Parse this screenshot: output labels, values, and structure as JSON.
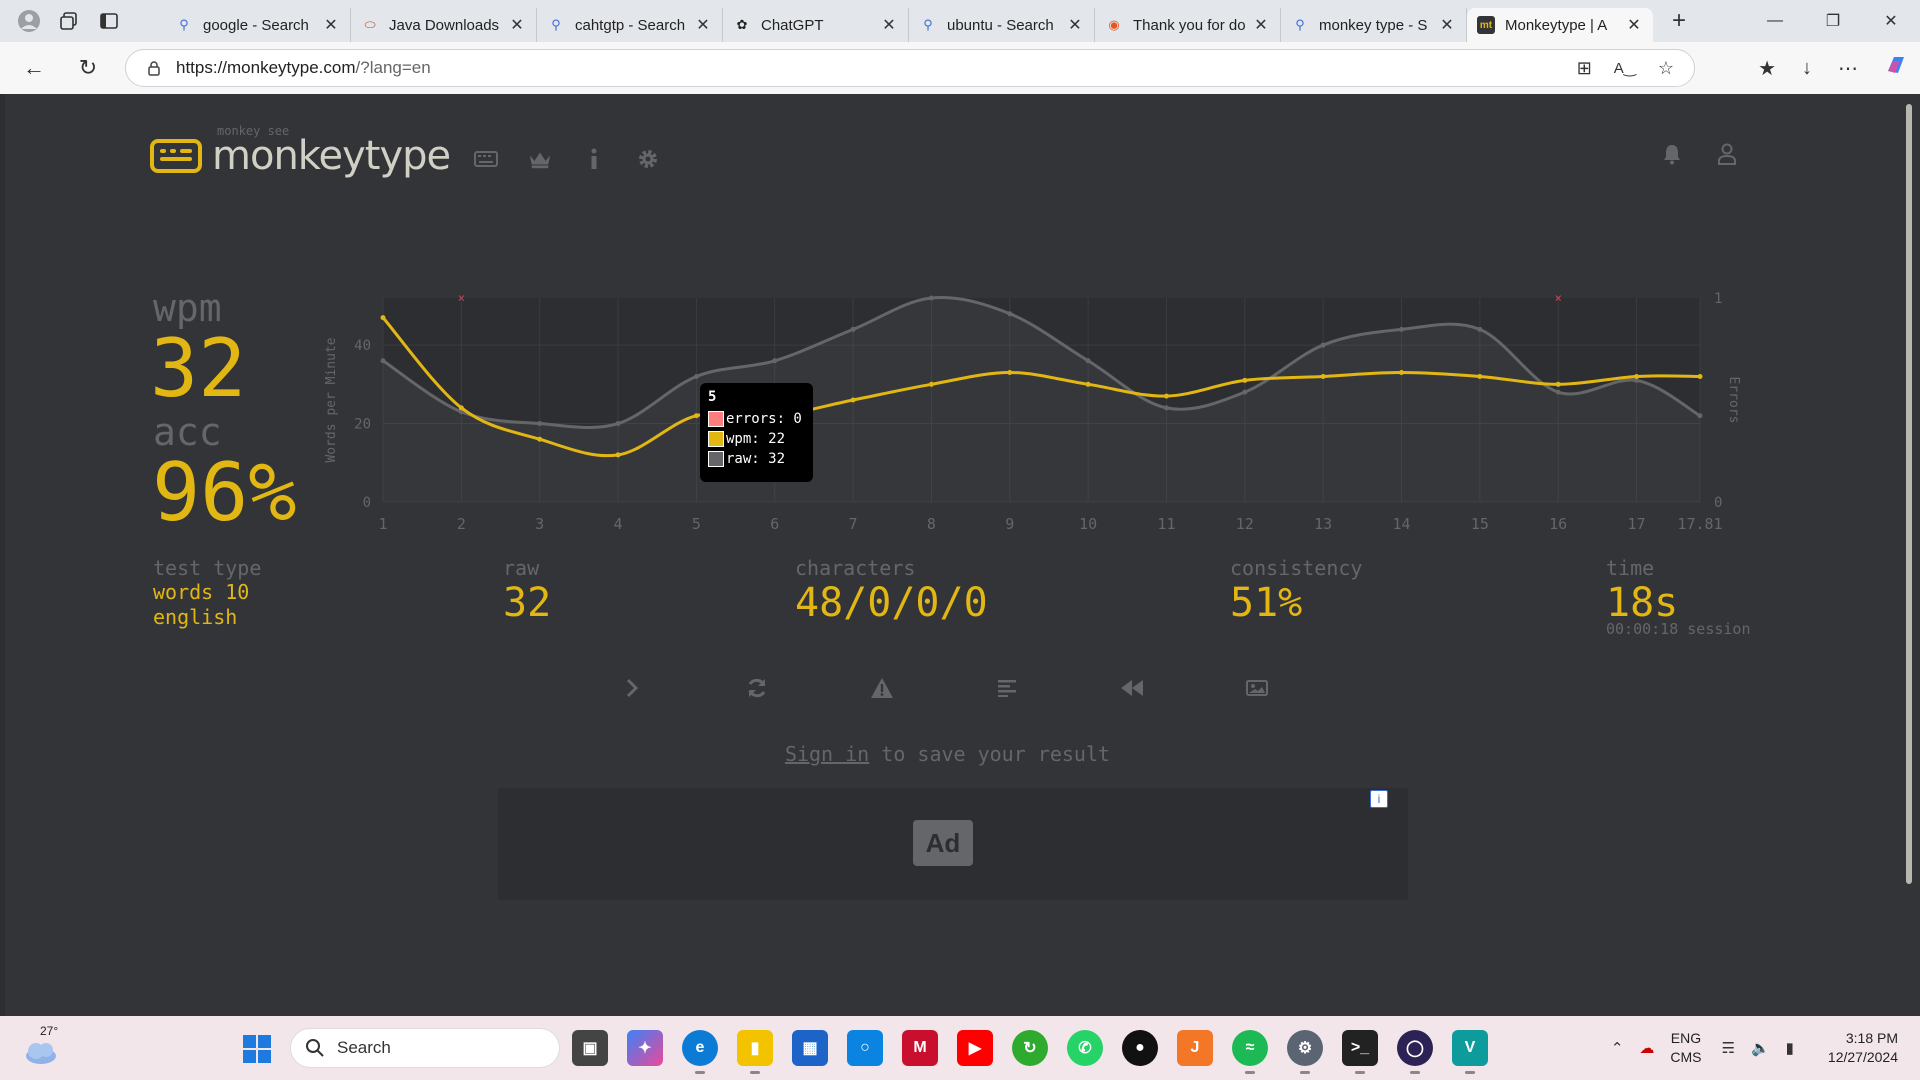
{
  "browser": {
    "tabs": [
      {
        "title": "google - Search",
        "fav": "search-icon"
      },
      {
        "title": "Java Downloads",
        "fav": "oracle-icon"
      },
      {
        "title": "cahtgtp - Search",
        "fav": "search-icon"
      },
      {
        "title": "ChatGPT",
        "fav": "chatgpt-icon"
      },
      {
        "title": "ubuntu - Search",
        "fav": "search-icon"
      },
      {
        "title": "Thank you for do",
        "fav": "ubuntu-icon"
      },
      {
        "title": "monkey type - S",
        "fav": "search-icon"
      },
      {
        "title": "Monkeytype | A",
        "fav": "monkeytype-icon",
        "active": true
      }
    ],
    "url_host": "https://monkeytype.com",
    "url_path": "/?lang=en"
  },
  "app": {
    "logo_small": "monkey see",
    "logo_big": "monkeytype",
    "accent": "#e2b714",
    "bg": "#323437",
    "sub": "#646669",
    "text": "#d1d0c5",
    "error": "#ca4754"
  },
  "result": {
    "wpm_label": "wpm",
    "wpm_value": "32",
    "acc_label": "acc",
    "acc_value": "96%",
    "test_type_label": "test type",
    "test_type_line1": "words 10",
    "test_type_line2": "english",
    "raw_label": "raw",
    "raw_value": "32",
    "characters_label": "characters",
    "characters_value": "48/0/0/0",
    "consistency_label": "consistency",
    "consistency_value": "51%",
    "time_label": "time",
    "time_value": "18s",
    "time_session": "00:00:18 session",
    "signin_link": "Sign in",
    "signin_rest": " to save your result",
    "ad_badge": "Ad",
    "ad_info": "i"
  },
  "tooltip": {
    "header": "5",
    "errors": "errors: 0",
    "wpm": "wpm: 22",
    "raw": "raw: 32"
  },
  "chart_data": {
    "type": "line",
    "ylabel": "Words per Minute",
    "y2label": "Errors",
    "x": [
      1,
      2,
      3,
      4,
      5,
      6,
      7,
      8,
      9,
      10,
      11,
      12,
      13,
      14,
      15,
      16,
      17,
      17.81
    ],
    "xtick_labels": [
      "1",
      "2",
      "3",
      "4",
      "5",
      "6",
      "7",
      "8",
      "9",
      "10",
      "11",
      "12",
      "13",
      "14",
      "15",
      "16",
      "17",
      "17.81"
    ],
    "ylim": [
      0,
      52
    ],
    "yticks": [
      0,
      20,
      40
    ],
    "y2lim": [
      0,
      1
    ],
    "y2ticks": [
      0,
      1
    ],
    "series": [
      {
        "name": "raw",
        "color": "#646669",
        "values": [
          36,
          23,
          20,
          20,
          32,
          36,
          44,
          52,
          48,
          36,
          24,
          28,
          40,
          44,
          44,
          28,
          31,
          22
        ]
      },
      {
        "name": "wpm",
        "color": "#e2b714",
        "values": [
          47,
          24,
          16,
          12,
          22,
          22,
          26,
          30,
          33,
          30,
          27,
          31,
          32,
          33,
          32,
          30,
          32,
          32
        ]
      },
      {
        "name": "errors",
        "color": "#ca4754",
        "points": [
          {
            "x": 2,
            "y": 1
          },
          {
            "x": 16,
            "y": 1
          }
        ]
      }
    ],
    "grid": true
  },
  "taskbar": {
    "weather_temp": "27°",
    "search_placeholder": "Search",
    "lang_line1": "ENG",
    "lang_line2": "CMS",
    "time": "3:18 PM",
    "date": "12/27/2024"
  }
}
